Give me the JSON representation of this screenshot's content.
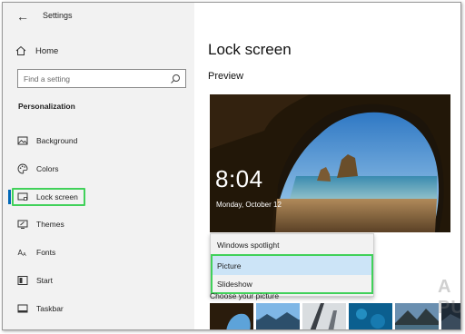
{
  "window": {
    "title": "Settings",
    "back_icon": "back-arrow-icon"
  },
  "sidebar": {
    "home_label": "Home",
    "search_placeholder": "Find a setting",
    "section_heading": "Personalization",
    "items": [
      {
        "label": "Background",
        "icon": "picture-icon"
      },
      {
        "label": "Colors",
        "icon": "palette-icon"
      },
      {
        "label": "Lock screen",
        "icon": "lock-screen-icon",
        "active": true
      },
      {
        "label": "Themes",
        "icon": "brush-icon"
      },
      {
        "label": "Fonts",
        "icon": "font-icon"
      },
      {
        "label": "Start",
        "icon": "start-icon"
      },
      {
        "label": "Taskbar",
        "icon": "taskbar-icon"
      }
    ]
  },
  "main": {
    "title": "Lock screen",
    "preview_label": "Preview",
    "preview": {
      "time": "8:04",
      "date": "Monday, October 12"
    },
    "background_dropdown": {
      "options": [
        {
          "label": "Windows spotlight"
        },
        {
          "label": "Picture",
          "selected": true
        },
        {
          "label": "Slideshow"
        }
      ]
    },
    "choose_picture_label": "Choose your picture"
  },
  "colors": {
    "accent": "#0067b8",
    "highlight_outline": "#41d15a",
    "sidebar_bg": "#f2f2f2",
    "selected_option_bg": "#cce4f7"
  },
  "watermark": "A PUALS"
}
